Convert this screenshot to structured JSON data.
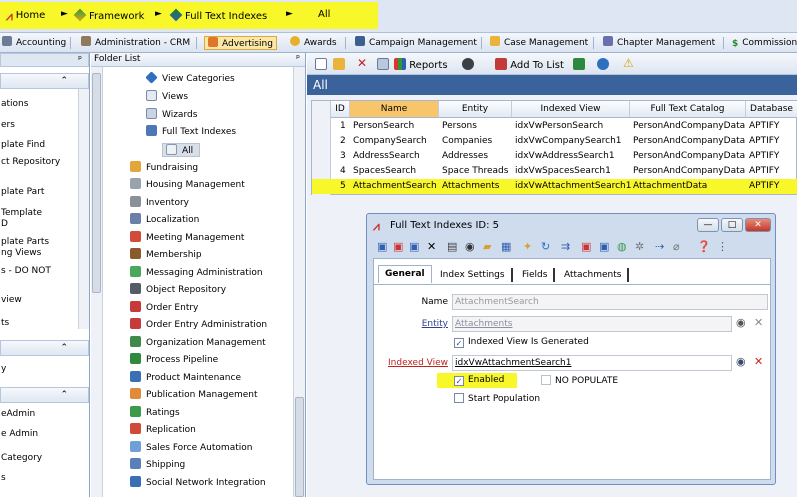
{
  "breadcrumb": {
    "items": [
      "Home",
      "Framework",
      "Full Text Indexes",
      "All"
    ],
    "separator": "►"
  },
  "module_tabs": [
    "Accounting",
    "Administration - CRM",
    "Advertising",
    "Awards",
    "Campaign Management",
    "Case Management",
    "Chapter Management",
    "Commissions"
  ],
  "left_panel": {
    "lines_top": [
      "ations",
      "ers",
      "plate Find",
      "ct Repository",
      "plate Part",
      "Template",
      "D",
      "plate Parts",
      "ng Views",
      "s - DO NOT",
      "view",
      "ts"
    ],
    "lines_mid": [
      "y"
    ],
    "lines_bottom": [
      "eAdmin",
      "e Admin",
      "Category",
      "s"
    ],
    "chevron": "⌃",
    "pin": "ᵖ"
  },
  "folder": {
    "header": "Folder List",
    "items": [
      "View Categories",
      "Views",
      "Wizards",
      "Full Text Indexes",
      "All",
      "Fundraising",
      "Housing Management",
      "Inventory",
      "Localization",
      "Meeting Management",
      "Membership",
      "Messaging Administration",
      "Object Repository",
      "Order Entry",
      "Order Entry Administration",
      "Organization Management",
      "Process Pipeline",
      "Product Maintenance",
      "Publication Management",
      "Ratings",
      "Replication",
      "Sales Force Automation",
      "Shipping",
      "Social Network Integration"
    ]
  },
  "toolbar": {
    "reports": "Reports",
    "add_to_list": "Add To List"
  },
  "banner": "All",
  "grid": {
    "headers": [
      "ID",
      "Name",
      "Entity",
      "Indexed View",
      "Full Text Catalog",
      "Database"
    ],
    "rows": [
      [
        "1",
        "PersonSearch",
        "Persons",
        "idxVwPersonSearch",
        "PersonAndCompanyData",
        "APTIFY"
      ],
      [
        "2",
        "CompanySearch",
        "Companies",
        "idxVwCompanySearch1",
        "PersonAndCompanyData",
        "APTIFY"
      ],
      [
        "3",
        "AddressSearch",
        "Addresses",
        "idxVwAddressSearch1",
        "PersonAndCompanyData",
        "APTIFY"
      ],
      [
        "4",
        "SpacesSearch",
        "Space Threads",
        "idxVwSpacesSearch1",
        "PersonAndCompanyData",
        "APTIFY"
      ],
      [
        "5",
        "AttachmentSearch",
        "Attachments",
        "idxVwAttachmentSearch1",
        "AttachmentData",
        "APTIFY"
      ]
    ],
    "selected_row": 4
  },
  "dialog": {
    "title": "Full Text Indexes ID: 5",
    "tabs": [
      "General",
      "Index Settings",
      "Fields",
      "Attachments"
    ],
    "name_label": "Name",
    "name_value": "AttachmentSearch",
    "entity_label": "Entity",
    "entity_value": "Attachments",
    "indexed_view_generated": "Indexed View Is Generated",
    "indexed_view_label": "Indexed View",
    "indexed_view_value": "idxVwAttachmentSearch1",
    "enabled": "Enabled",
    "no_populate": "NO POPULATE",
    "start_population": "Start Population",
    "checked": "✓"
  },
  "colors": {
    "highlight": "#f7f72a",
    "banner": "#3b639b"
  }
}
